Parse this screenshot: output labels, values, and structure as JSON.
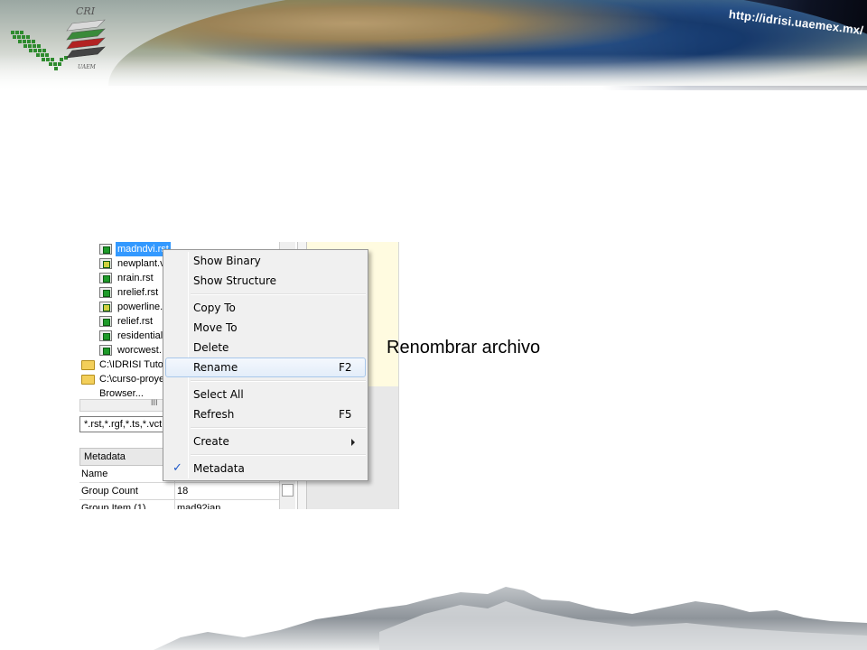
{
  "banner": {
    "url_text": "http://idrisi.uaemex.mx/",
    "logo_text_top": "CRI",
    "logo_text_bottom": "UAEM"
  },
  "tree": {
    "items": [
      {
        "label": "madndvi.rst",
        "type": "raster",
        "selected": true
      },
      {
        "label": "newplant.v",
        "type": "vector"
      },
      {
        "label": "nrain.rst",
        "type": "raster"
      },
      {
        "label": "nrelief.rst",
        "type": "raster"
      },
      {
        "label": "powerline.",
        "type": "vector"
      },
      {
        "label": "relief.rst",
        "type": "raster"
      },
      {
        "label": "residential",
        "type": "raster"
      },
      {
        "label": "worcwest.",
        "type": "raster"
      }
    ],
    "folders": [
      {
        "label": "C:\\IDRISI Tuto"
      },
      {
        "label": "C:\\curso-proye"
      }
    ],
    "browser_label": "Browser...",
    "hscroll_grip": "III"
  },
  "filter": {
    "value": "*.rst,*.rgf,*.ts,*.vct"
  },
  "metadata": {
    "header": "Metadata",
    "rows": [
      {
        "key": "Name",
        "value": ""
      },
      {
        "key": "Group Count",
        "value": "18"
      },
      {
        "key": "Group Item (1)",
        "value": "mad92jan"
      }
    ]
  },
  "context_menu": {
    "items": [
      {
        "label": "Show Binary"
      },
      {
        "label": "Show Structure"
      },
      {
        "label": "Copy To"
      },
      {
        "label": "Move To"
      },
      {
        "label": "Delete"
      },
      {
        "label": "Rename",
        "shortcut": "F2",
        "highlighted": true
      },
      {
        "label": "Select All"
      },
      {
        "label": "Refresh",
        "shortcut": "F5"
      },
      {
        "label": "Create"
      },
      {
        "label": "Metadata",
        "checked": true
      }
    ],
    "check_glyph": "✓"
  },
  "caption": {
    "text": "Renombrar archivo"
  },
  "colors": {
    "selection": "#3399ff",
    "menu_bg": "#f0f0f0",
    "menu_highlight_border": "#a8c7ea",
    "check": "#1f58c8",
    "panel_right": "#fffbe0"
  }
}
